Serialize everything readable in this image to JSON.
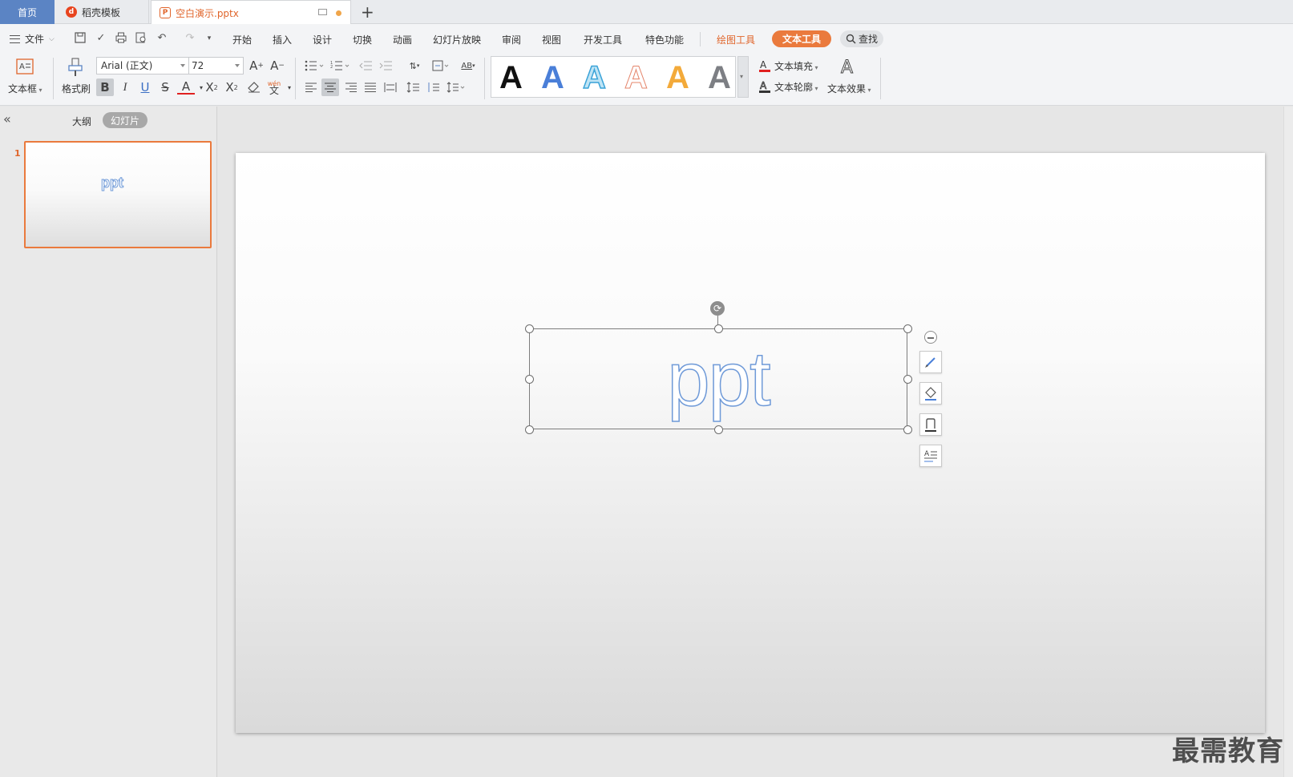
{
  "tabs": {
    "home": "首页",
    "template": "稻壳模板",
    "document": "空白演示.pptx",
    "add": "+"
  },
  "menubar": {
    "file": "文件",
    "items": [
      "开始",
      "插入",
      "设计",
      "切换",
      "动画",
      "幻灯片放映",
      "审阅",
      "视图",
      "开发工具",
      "特色功能"
    ],
    "drawing_tools": "绘图工具",
    "text_tools": "文本工具",
    "search": "查找"
  },
  "ribbon": {
    "textbox_label": "文本框",
    "format_painter_label": "格式刷",
    "font_name": "Arial (正文)",
    "font_size": "72",
    "text_fill_label": "文本填充",
    "text_outline_label": "文本轮廓",
    "text_effect_label": "文本效果",
    "gallery_letter": "A",
    "pinyin_glyph": "wén",
    "pinyin_char": "文"
  },
  "left_panel": {
    "outline_tab": "大纲",
    "slides_tab": "幻灯片",
    "thumb_number": "1",
    "thumb_text": "ppt"
  },
  "slide": {
    "text": "ppt"
  },
  "watermark": "最需教育",
  "colors": {
    "accent": "#ea7a3d",
    "text_outline": "#6f9ad8",
    "home_tab": "#5b84c4"
  }
}
